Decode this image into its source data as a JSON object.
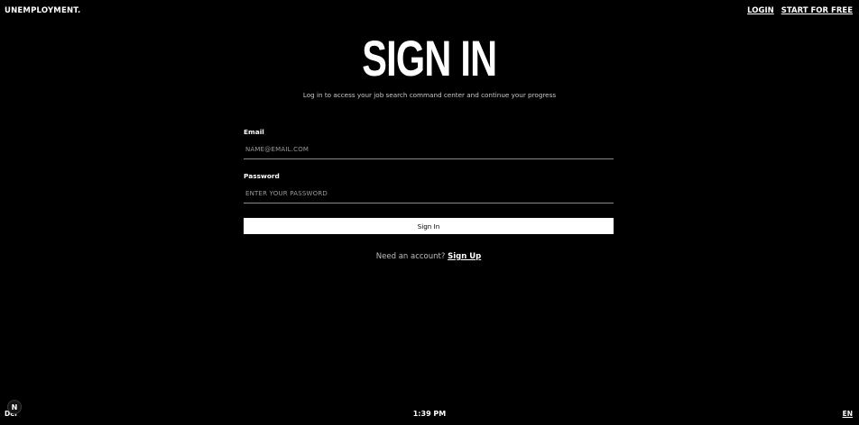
{
  "header": {
    "logo": "UNEMPLOYMENT.",
    "nav": {
      "login": "LOGIN",
      "start_free": "START FOR FREE"
    }
  },
  "main": {
    "title": "SIGN IN",
    "subtitle": "Log in to access your job search command center and continue your progress",
    "form": {
      "email_label": "Email",
      "email_placeholder": "NAME@EMAIL.COM",
      "email_value": "",
      "password_label": "Password",
      "password_placeholder": "ENTER YOUR PASSWORD",
      "password_value": "",
      "submit_label": "Sign In"
    },
    "signup": {
      "prompt": "Need an account?",
      "link": "Sign Up"
    }
  },
  "footer": {
    "left_text": "Del",
    "badge": "N",
    "time": "1:39 PM",
    "language": "EN"
  },
  "colors": {
    "background": "#000000",
    "text": "#ffffff",
    "muted": "#bdbdbd",
    "button_bg": "#ffffff",
    "button_text": "#000000"
  }
}
